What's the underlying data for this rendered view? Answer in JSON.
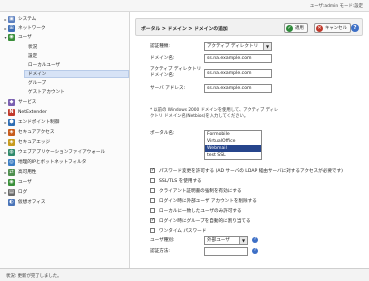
{
  "topbar": {
    "user_info": "ユーザ:admin モード:設定"
  },
  "sidebar": {
    "items": [
      {
        "label": "システム",
        "icon": "monitor-icon",
        "color": "#5b7fbf",
        "glyph": "▣",
        "expand": "▸"
      },
      {
        "label": "ネットワーク",
        "icon": "network-icon",
        "color": "#3f6fb7",
        "glyph": "⊞",
        "expand": "▸"
      },
      {
        "label": "ユーザ",
        "icon": "users-icon",
        "color": "#3a8f3a",
        "glyph": "◉",
        "expand": "▾"
      },
      {
        "label": "状況",
        "icon": "",
        "color": "",
        "glyph": "",
        "expand": ""
      },
      {
        "label": "設定",
        "icon": "",
        "color": "",
        "glyph": "",
        "expand": ""
      },
      {
        "label": "ローカルユーザ",
        "icon": "",
        "color": "",
        "glyph": "",
        "expand": ""
      },
      {
        "label": "ドメイン",
        "icon": "",
        "color": "",
        "glyph": "",
        "expand": ""
      },
      {
        "label": "グループ",
        "icon": "",
        "color": "",
        "glyph": "",
        "expand": ""
      },
      {
        "label": "ゲストアカウント",
        "icon": "",
        "color": "",
        "glyph": "",
        "expand": ""
      },
      {
        "label": "サービス",
        "icon": "services-icon",
        "color": "#7a5fb0",
        "glyph": "◆",
        "expand": "▸"
      },
      {
        "label": "NetExtender",
        "icon": "netextender-icon",
        "color": "#c0392b",
        "glyph": "N",
        "expand": "▸"
      },
      {
        "label": "エンドポイント制御",
        "icon": "endpoint-icon",
        "color": "#2e6db4",
        "glyph": "⬢",
        "expand": "▸"
      },
      {
        "label": "セキュアアクセス",
        "icon": "secure-access-icon",
        "color": "#c75b1c",
        "glyph": "◈",
        "expand": "▸"
      },
      {
        "label": "セキュアエッジ",
        "icon": "secure-edge-icon",
        "color": "#c79a1c",
        "glyph": "◈",
        "expand": "▸"
      },
      {
        "label": "ウェブアプリケーションファイアウォール",
        "icon": "waf-icon",
        "color": "#2f8a6b",
        "glyph": "◍",
        "expand": "▸"
      },
      {
        "label": "地理的IPとボットネットフィルタ",
        "icon": "geoip-icon",
        "color": "#3b7dc4",
        "glyph": "◎",
        "expand": "▸"
      },
      {
        "label": "高可用性",
        "icon": "ha-icon",
        "color": "#4e8f4e",
        "glyph": "⇄",
        "expand": "▸"
      },
      {
        "label": "ユーザ",
        "icon": "user-icon",
        "color": "#3a8f3a",
        "glyph": "◉",
        "expand": "▸"
      },
      {
        "label": "ログ",
        "icon": "log-icon",
        "color": "#6a6a6a",
        "glyph": "▤",
        "expand": "▸"
      },
      {
        "label": "仮想オフィス",
        "icon": "virtual-office-icon",
        "color": "#4a74b8",
        "glyph": "◐",
        "expand": ""
      }
    ]
  },
  "header": {
    "title": "ポータル > ドメイン > ドメインの追加",
    "apply_label": "適用",
    "cancel_label": "キャンセル",
    "help_glyph": "?"
  },
  "form": {
    "auth_type_label": "認証種類:",
    "auth_type_value": "アクティブ ディレクトリ",
    "domain_name_label": "ドメイン名:",
    "domain_name_value": "ss.na.example.com",
    "ad_domain_label": "アクティブ ディレクトリ ドメイン名:",
    "ad_domain_value": "ss.na.example.com",
    "server_label": "サーバ アドレス:",
    "server_value": "ss.na.example.com",
    "note": "* 以前の Windows 2000 ドメインを使用して、アクティブ ディレクトリ ドメイン名(Netbios)を入力してください。",
    "portal_label": "ポータル名:",
    "portals": [
      {
        "label": "Formobile",
        "selected": false
      },
      {
        "label": "VirtualOffice",
        "selected": false
      },
      {
        "label": "Webmail",
        "selected": true
      },
      {
        "label": "test SSL",
        "selected": false
      }
    ],
    "checkboxes": [
      {
        "label": "パスワード変更を許可する (AD サーバの LDAP 経由サーバに対するアクセスが必要です)",
        "checked": true
      },
      {
        "label": "SSL/TLS を使用する",
        "checked": false
      },
      {
        "label": "クライアント証明書の強制を有効にする",
        "checked": false
      },
      {
        "label": "ログイン時に外部ユーザ アカウントを削除する",
        "checked": false
      },
      {
        "label": "ローカルに一致したユーザのみ許可する",
        "checked": false
      },
      {
        "label": "ログイン時にグループを自動的に割り当てる",
        "checked": true
      },
      {
        "label": "ワンタイム パスワード",
        "checked": false
      }
    ],
    "user_type_label": "ユーザ種別:",
    "user_type_value": "外部ユーザ",
    "auth_hint_label": "認証方法:",
    "auth_hint_value": ""
  },
  "status": {
    "text": "状況: 更新が完了しました。"
  },
  "colors": {
    "apply": "#2f8a3a",
    "cancel": "#c0392b",
    "help": "#3d6fc6",
    "list_highlight": "#26458c"
  }
}
